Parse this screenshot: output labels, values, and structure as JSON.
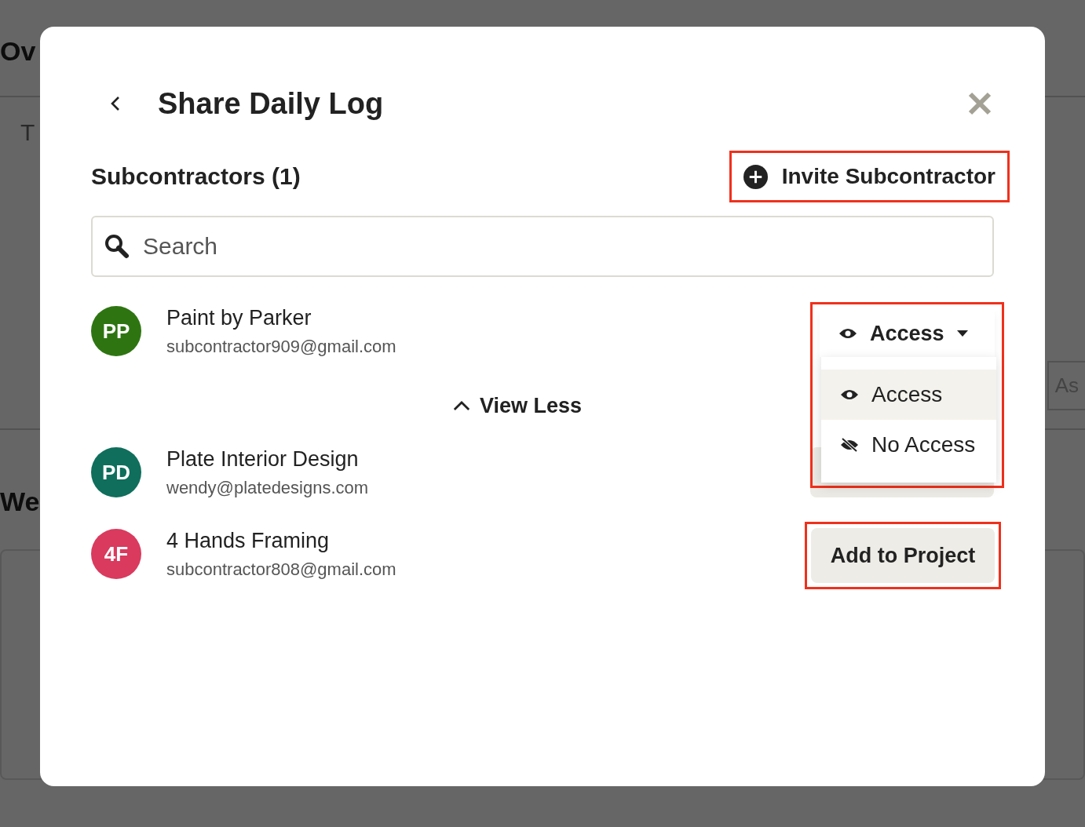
{
  "background": {
    "heading_1": "Ov",
    "placeholder": "T",
    "button_text": "As",
    "heading_2": "We"
  },
  "modal": {
    "title": "Share Daily Log",
    "section_title": "Subcontractors (1)",
    "invite_label": "Invite Subcontractor",
    "search": {
      "placeholder": "Search"
    },
    "toggle_label": "View Less"
  },
  "rows": [
    {
      "initials": "PP",
      "color": "#2e7512",
      "name": "Paint by Parker",
      "email": "subcontractor909@gmail.com",
      "kind": "access"
    },
    {
      "initials": "PD",
      "color": "#0f6e5c",
      "name": "Plate Interior Design",
      "email": "wendy@platedesigns.com",
      "kind": "covered"
    },
    {
      "initials": "4F",
      "color": "#d93a5e",
      "name": "4 Hands Framing",
      "email": "subcontractor808@gmail.com",
      "kind": "add",
      "action_label": "Add to Project"
    }
  ],
  "access": {
    "value": "Access",
    "options": [
      {
        "kind": "eye",
        "label": "Access",
        "selected": true
      },
      {
        "kind": "eye-off",
        "label": "No Access",
        "selected": false
      }
    ]
  }
}
